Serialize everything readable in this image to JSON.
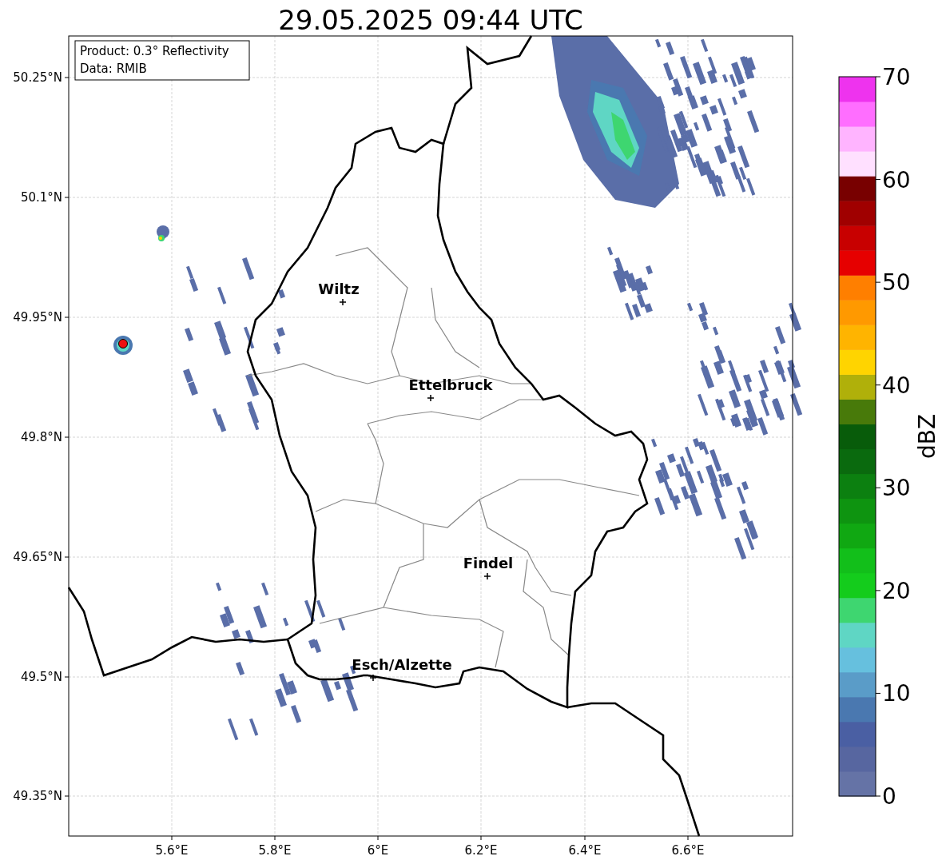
{
  "title": "29.05.2025 09:44 UTC",
  "info_box": [
    "Product: 0.3° Reflectivity",
    "Data: RMIB"
  ],
  "x_ticks": [
    "5.6°E",
    "5.8°E",
    "6°E",
    "6.2°E",
    "6.4°E",
    "6.6°E"
  ],
  "y_ticks": [
    "50.25°N",
    "50.1°N",
    "49.95°N",
    "49.8°N",
    "49.65°N",
    "49.5°N",
    "49.35°N"
  ],
  "cities": [
    {
      "name": "Wiltz"
    },
    {
      "name": "Ettelbruck"
    },
    {
      "name": "Findel"
    },
    {
      "name": "Esch/Alzette"
    }
  ],
  "colorbar": {
    "label": "dBZ",
    "ticks": [
      "70",
      "60",
      "50",
      "40",
      "30",
      "20",
      "10",
      "0"
    ]
  }
}
